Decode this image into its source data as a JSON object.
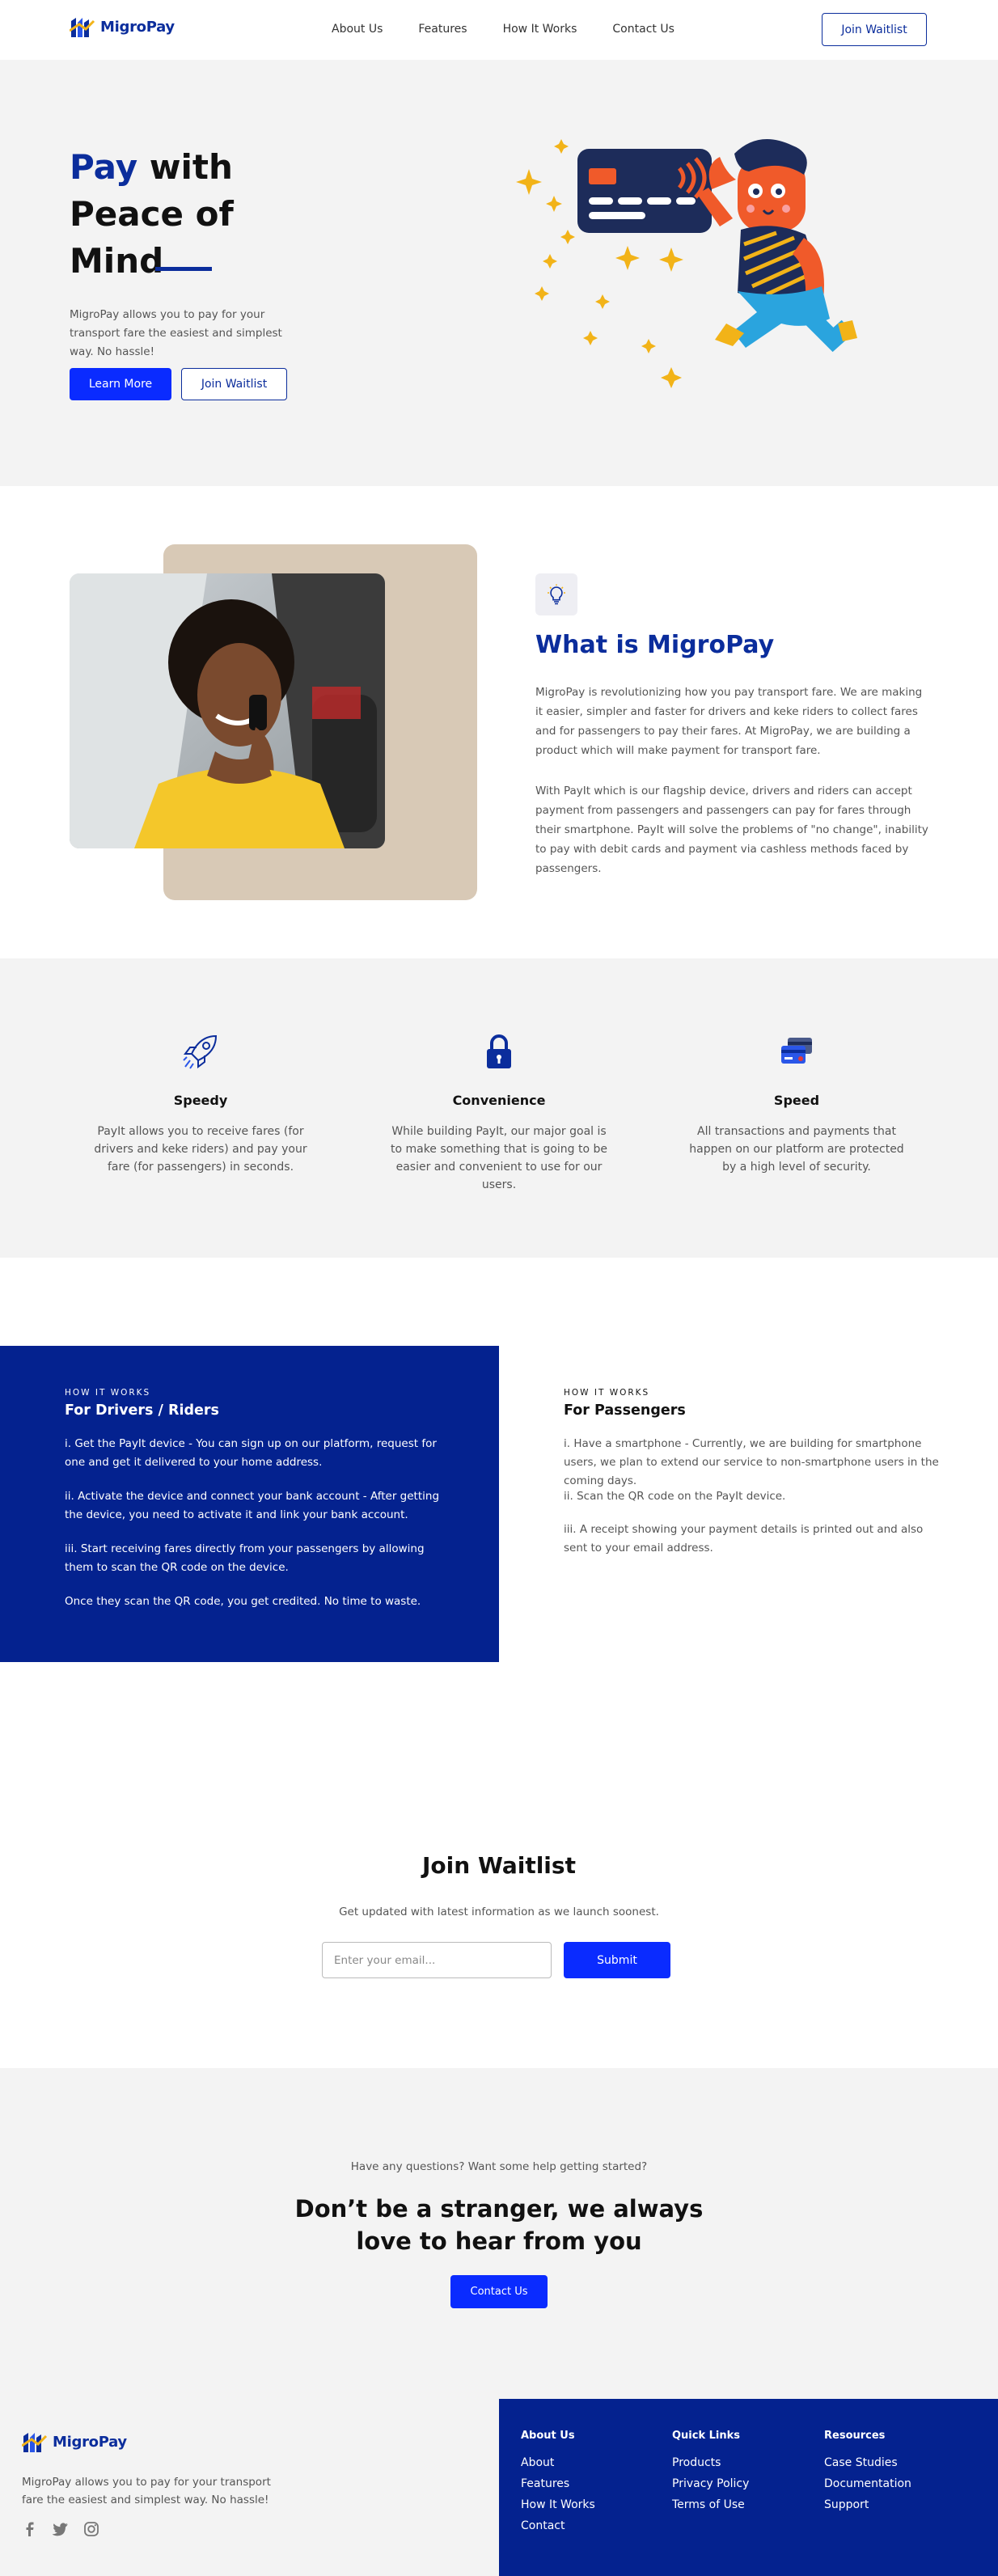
{
  "brand": {
    "name": "MigroPay",
    "primary_color": "#0b2d9c",
    "accent_button_color": "#0a2bff",
    "dark_band_color": "#04228f"
  },
  "nav": {
    "links": [
      "About Us",
      "Features",
      "How It Works",
      "Contact Us"
    ],
    "cta": "Join Waitlist"
  },
  "hero": {
    "title_accent": "Pay",
    "title_line1_rest": " with",
    "title_line2": "Peace of",
    "title_line3": "Mind",
    "description": "MigroPay allows you to pay for your transport fare the easiest and simplest way. No hassle!",
    "primary_button": "Learn More",
    "secondary_button": "Join Waitlist"
  },
  "about": {
    "icon": "lightbulb-icon",
    "title": "What is MigroPay",
    "paragraph1": "MigroPay is revolutionizing how you pay transport fare. We are making it easier, simpler and faster for drivers and keke riders to collect fares and for passengers to pay their fares. At MigroPay, we are building a product which will make payment for transport fare.",
    "paragraph2": "With PayIt which is our flagship device, drivers and riders can accept payment from passengers and passengers can pay for fares through their smartphone. PayIt will solve the problems of \"no change\", inability to pay with debit cards and payment via cashless methods faced by passengers."
  },
  "features": [
    {
      "icon": "rocket-icon",
      "title": "Speedy",
      "description": "PayIt allows you to receive fares (for drivers and keke riders) and pay your fare (for passengers) in seconds."
    },
    {
      "icon": "lock-icon",
      "title": "Convenience",
      "description": "While building PayIt, our major goal is to make something that is going to be easier and convenient to use for our users."
    },
    {
      "icon": "cards-icon",
      "title": "Speed",
      "description": "All transactions and payments that happen on our platform are protected by a high level of security."
    }
  ],
  "how_it_works": {
    "drivers": {
      "kicker": "HOW IT WORKS",
      "heading": "For Drivers / Riders",
      "items": [
        "i. Get the PayIt device - You can sign up on our platform, request for one and get it delivered to your home address.",
        "ii. Activate the device and connect your bank account - After getting the device, you need to activate it and link your bank account.",
        "iii. Start receiving fares directly from your passengers by allowing them to scan the QR code on the device.",
        "Once they scan the QR code, you get credited. No time to waste."
      ]
    },
    "passengers": {
      "kicker": "HOW IT WORKS",
      "heading": "For Passengers",
      "items": [
        "i. Have a smartphone - Currently, we are building for smartphone users, we plan to extend our service to non-smartphone users in the coming days.",
        "ii. Scan the QR code on the PayIt device.",
        "iii. A receipt showing your payment details is printed out and also sent to your email address."
      ]
    }
  },
  "waitlist": {
    "title": "Join Waitlist",
    "subtitle": "Get updated with latest information as we launch soonest.",
    "email_placeholder": "Enter your email...",
    "email_value": "",
    "submit": "Submit"
  },
  "contact": {
    "question": "Have any questions? Want some help getting started?",
    "title_line1": "Don’t be a stranger, we always",
    "title_line2": "love to hear from you",
    "button": "Contact Us"
  },
  "footer": {
    "description": "MigroPay allows you to pay for your transport fare the easiest and simplest way. No hassle!",
    "socials": [
      "facebook-icon",
      "twitter-icon",
      "instagram-icon"
    ],
    "columns": [
      {
        "title": "About Us",
        "links": [
          "About",
          "Features",
          "How It Works",
          "Contact"
        ]
      },
      {
        "title": "Quick Links",
        "links": [
          "Products",
          "Privacy Policy",
          "Terms of Use"
        ]
      },
      {
        "title": "Resources",
        "links": [
          "Case Studies",
          "Documentation",
          "Support"
        ]
      }
    ]
  }
}
